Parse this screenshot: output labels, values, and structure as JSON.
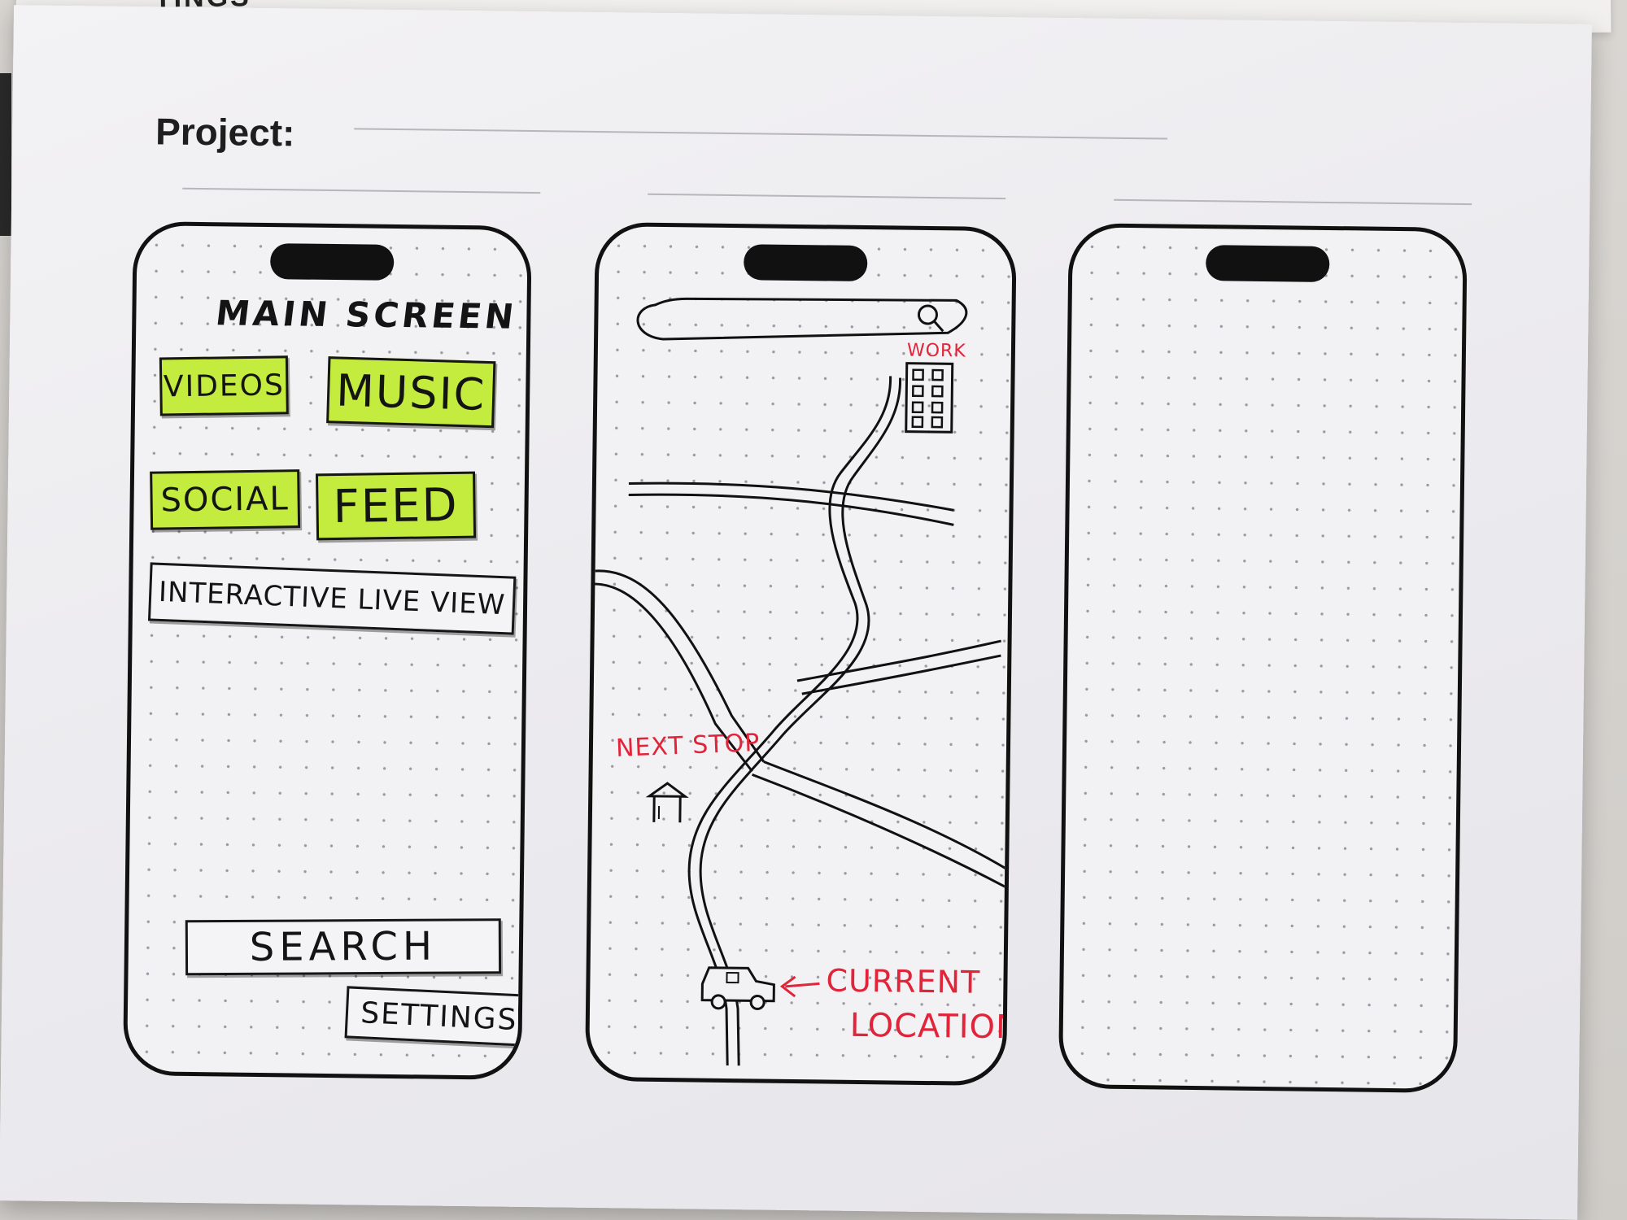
{
  "background_sheet": {
    "partial_text": "TINGS"
  },
  "page": {
    "project_label": "Project:"
  },
  "phone_left": {
    "title": "MAIN SCREEN",
    "buttons": {
      "videos": "VIDEOS",
      "music": "MUSIC",
      "social": "SOCIAL",
      "feed": "FEED",
      "interactive_live_view": "INTERACTIVE LIVE VIEW",
      "search": "SEARCH",
      "settings": "SETTINGS"
    }
  },
  "phone_middle": {
    "labels": {
      "work": "WORK",
      "next_stop": "NEXT STOP",
      "current_location_line1": "CURRENT",
      "current_location_line2": "LOCATION"
    }
  },
  "colors": {
    "highlighter_green": "#c4ec3e",
    "annotation_red": "#e2243a",
    "ink": "#141414"
  },
  "icons": [
    "magnifier-icon",
    "building-icon",
    "bus-stop-icon",
    "car-icon",
    "arrow-left-icon"
  ]
}
